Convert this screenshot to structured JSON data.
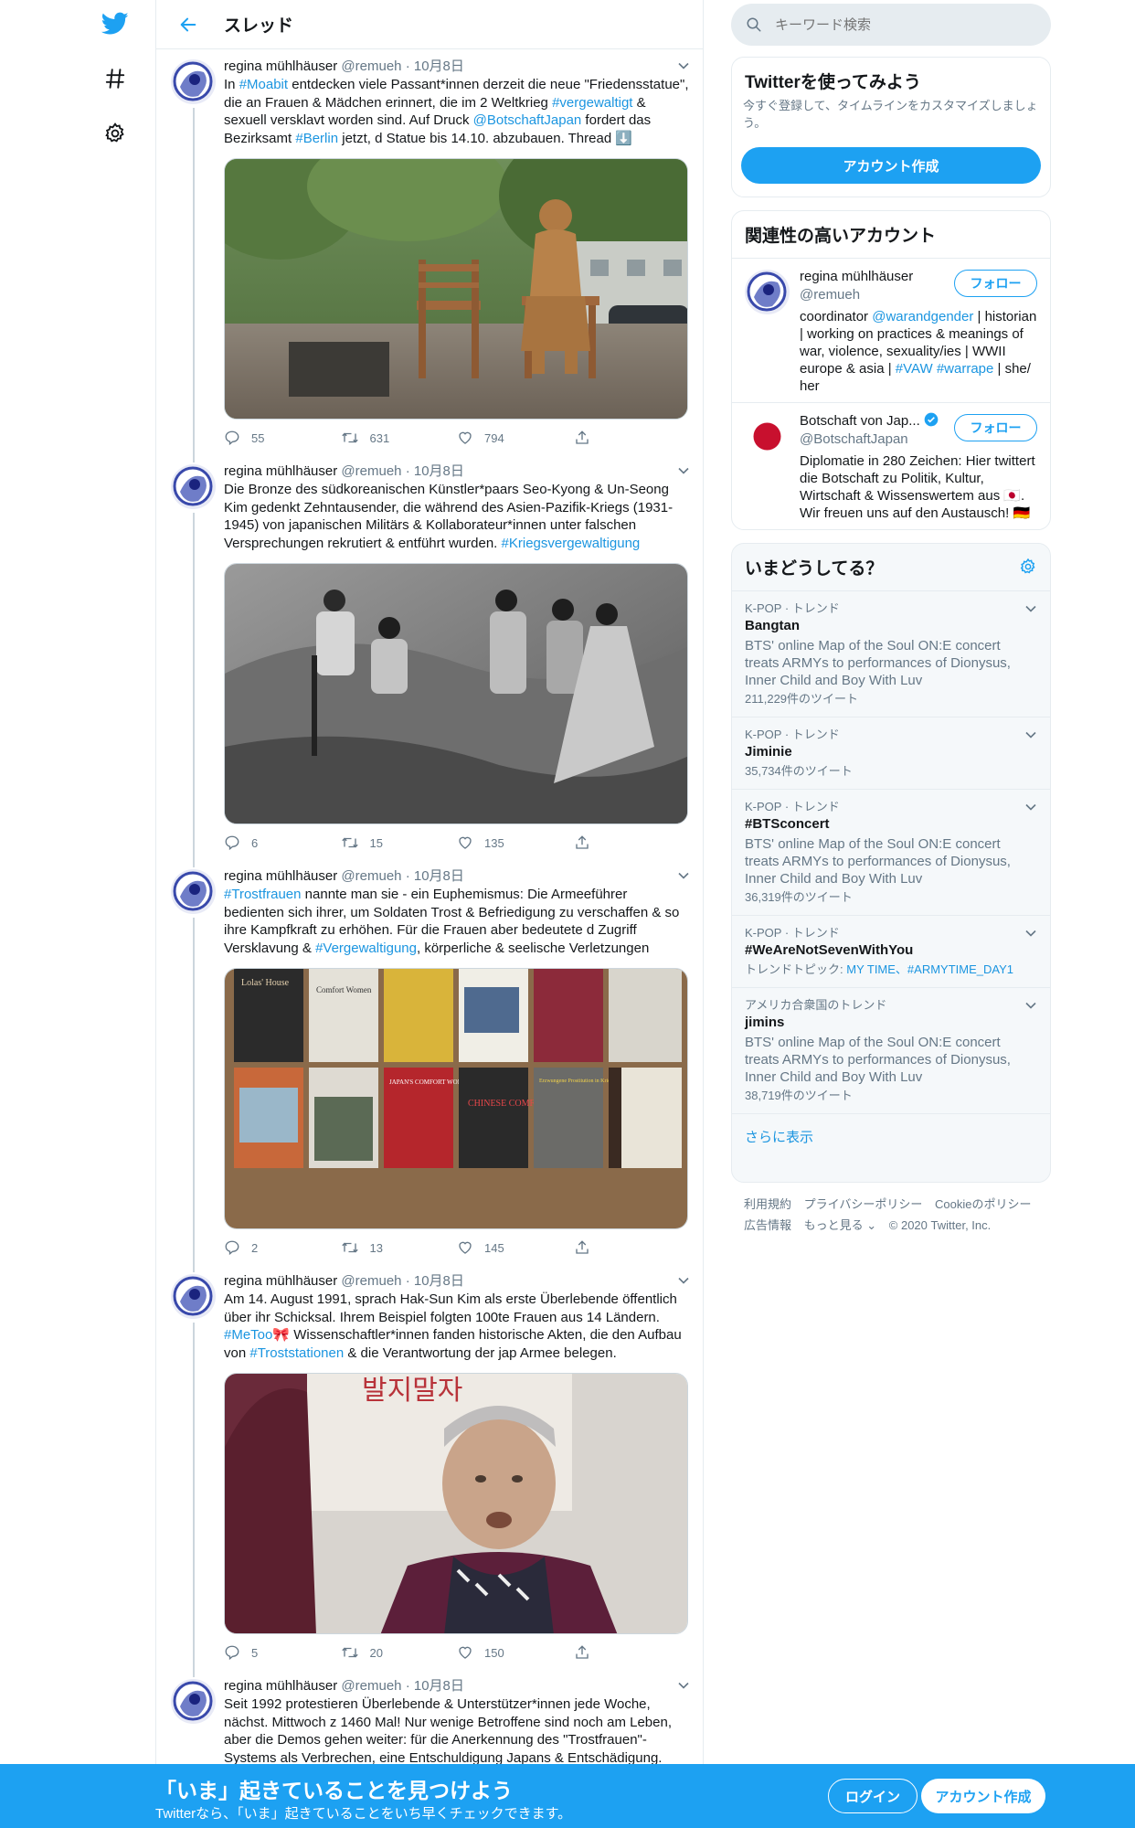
{
  "header": {
    "title": "スレッド"
  },
  "search": {
    "placeholder": "キーワード検索"
  },
  "signup_card": {
    "title": "Twitterを使ってみよう",
    "subtitle": "今すぐ登録して、タイムラインをカスタマイズしましょう。",
    "button": "アカウント作成"
  },
  "related": {
    "title": "関連性の高いアカウント",
    "accounts": [
      {
        "name": "regina mühlhäuser",
        "handle": "@remueh",
        "follow": "フォロー",
        "bio_parts": [
          "coordinator ",
          "@warandgender",
          " | historian | working on practices & meanings of war, violence, sexuality/ies | WWII europe & asia | ",
          "#VAW",
          " ",
          "#warrape",
          " | she/ her"
        ]
      },
      {
        "name": "Botschaft von Jap...",
        "handle": "@BotschaftJapan",
        "follow": "フォロー",
        "bio": "Diplomatie in 280 Zeichen: Hier twittert die Botschaft zu Politik, Kultur, Wirtschaft & Wissenswertem aus 🇯🇵. Wir freuen uns auf den Austausch! 🇩🇪"
      }
    ]
  },
  "trends": {
    "title": "いまどうしてる？",
    "items": [
      {
        "context": "K-POP · トレンド",
        "title": "Bangtan",
        "desc": "BTS' online Map of the Soul ON:E concert treats ARMYs to performances of Dionysus, Inner Child and Boy With Luv",
        "count": "211,229件のツイート"
      },
      {
        "context": "K-POP · トレンド",
        "title": "Jiminie",
        "count": "35,734件のツイート"
      },
      {
        "context": "K-POP · トレンド",
        "title": "#BTSconcert",
        "desc": "BTS' online Map of the Soul ON:E concert treats ARMYs to performances of Dionysus, Inner Child and Boy With Luv",
        "count": "36,319件のツイート"
      },
      {
        "context": "K-POP · トレンド",
        "title": "#WeAreNotSevenWithYou",
        "topics_label": "トレンドトピック: ",
        "topics": "MY TIME、#ARMYTIME_DAY1"
      },
      {
        "context": "アメリカ合衆国のトレンド",
        "title": "jimins",
        "desc": "BTS' online Map of the Soul ON:E concert treats ARMYs to performances of Dionysus, Inner Child and Boy With Luv",
        "count": "38,719件のツイート"
      }
    ],
    "show_more": "さらに表示"
  },
  "footer": {
    "line1": [
      "利用規約",
      "プライバシーポリシー",
      "Cookieのポリシー"
    ],
    "line2": [
      "広告情報",
      "もっと見る ⌄",
      "© 2020 Twitter, Inc."
    ]
  },
  "tweets": [
    {
      "name": "regina mühlhäuser",
      "handle": "@remueh",
      "date": "10月8日",
      "text_parts": [
        "In ",
        "#Moabit",
        " entdecken viele Passant*innen derzeit die neue \"Friedensstatue\", die an Frauen & Mädchen erinnert, die im 2 Weltkrieg ",
        "#vergewaltigt",
        " & sexuell versklavt worden sind. Auf Druck ",
        "@BotschaftJapan",
        " fordert das Bezirksamt ",
        "#Berlin",
        " jetzt, d Statue bis 14.10. abzubauen. Thread ⬇️"
      ],
      "replies": "55",
      "retweets": "631",
      "likes": "794"
    },
    {
      "name": "regina mühlhäuser",
      "handle": "@remueh",
      "date": "10月8日",
      "text_parts": [
        "Die Bronze des südkoreanischen Künstler*paars Seo-Kyong & Un-Seong Kim gedenkt Zehntausender, die während des Asien-Pazifik-Kriegs (1931-1945) von japanischen Militärs & Kollaborateur*innen unter falschen Versprechungen rekrutiert & entführt wurden. ",
        "#Kriegsvergewaltigung"
      ],
      "replies": "6",
      "retweets": "15",
      "likes": "135"
    },
    {
      "name": "regina mühlhäuser",
      "handle": "@remueh",
      "date": "10月8日",
      "text_parts": [
        "#Trostfrauen",
        " nannte man sie - ein Euphemismus: Die Armeeführer bedienten sich ihrer, um Soldaten Trost & Befriedigung zu verschaffen & so ihre Kampfkraft zu erhöhen. Für die Frauen aber bedeutete d Zugriff Versklavung & ",
        "#Vergewaltigung",
        ", körperliche & seelische Verletzungen"
      ],
      "replies": "2",
      "retweets": "13",
      "likes": "145"
    },
    {
      "name": "regina mühlhäuser",
      "handle": "@remueh",
      "date": "10月8日",
      "text_parts": [
        "Am 14. August 1991, sprach Hak-Sun Kim als erste Überlebende öffentlich über ihr Schicksal.  Ihrem Beispiel folgten 100te Frauen aus 14 Ländern. ",
        "#MeToo",
        "🎀  Wissenschaftler*innen fanden historische Akten, die den Aufbau von ",
        "#Troststationen",
        " & die Verantwortung der jap Armee belegen."
      ],
      "replies": "5",
      "retweets": "20",
      "likes": "150"
    },
    {
      "name": "regina mühlhäuser",
      "handle": "@remueh",
      "date": "10月8日",
      "text_parts": [
        "Seit 1992 protestieren Überlebende & Unterstützer*innen jede Woche, nächst. Mittwoch z 1460 Mal! Nur wenige Betroffene sind noch am Leben, aber die Demos gehen weiter: für die Anerkennung des \"Trostfrauen\"-Systems als Verbrechen, eine Entschuldigung Japans & Entschädigung."
      ]
    }
  ],
  "book_titles": [
    "Lolas' House",
    "Comfort Women",
    "",
    "",
    "",
    "",
    "",
    "",
    "JAPAN'S COMFORT WOMEN",
    "CHINESE COMFORT WOMEN",
    "Erzwungene Prostitution in Kriegs- und Friedenszeiten",
    ""
  ],
  "protest_sign": "발지말자",
  "bottom_bar": {
    "title": "「いま」起きていることを見つけよう",
    "subtitle": "Twitterなら、「いま」起きていることをいち早くチェックできます。",
    "login": "ログイン",
    "signup": "アカウント作成"
  }
}
